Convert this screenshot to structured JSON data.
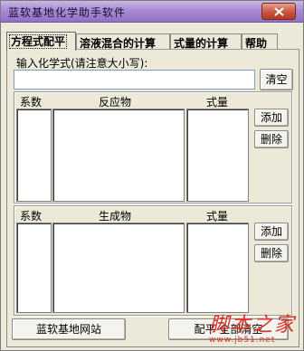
{
  "window": {
    "title": "蓝软基地化学助手软件"
  },
  "tabs": [
    {
      "label": "方程式配平"
    },
    {
      "label": "溶液混合的计算"
    },
    {
      "label": "式量的计算"
    },
    {
      "label": "帮助"
    }
  ],
  "formula": {
    "label": "输入化学式(请注意大小写):",
    "value": "",
    "clear_label": "清空"
  },
  "reactants": {
    "headers": {
      "coefficient": "系数",
      "substance": "反应物",
      "formula_weight": "式量"
    },
    "add_label": "添加",
    "delete_label": "删除"
  },
  "products": {
    "headers": {
      "coefficient": "系数",
      "substance": "生成物",
      "formula_weight": "式量"
    },
    "add_label": "添加",
    "delete_label": "删除"
  },
  "bottom": {
    "website_label": "蓝软基地网站",
    "right_label": "配平  全部清空"
  },
  "watermark": {
    "main": "脚本之家",
    "sub": "www.jb51.net"
  }
}
